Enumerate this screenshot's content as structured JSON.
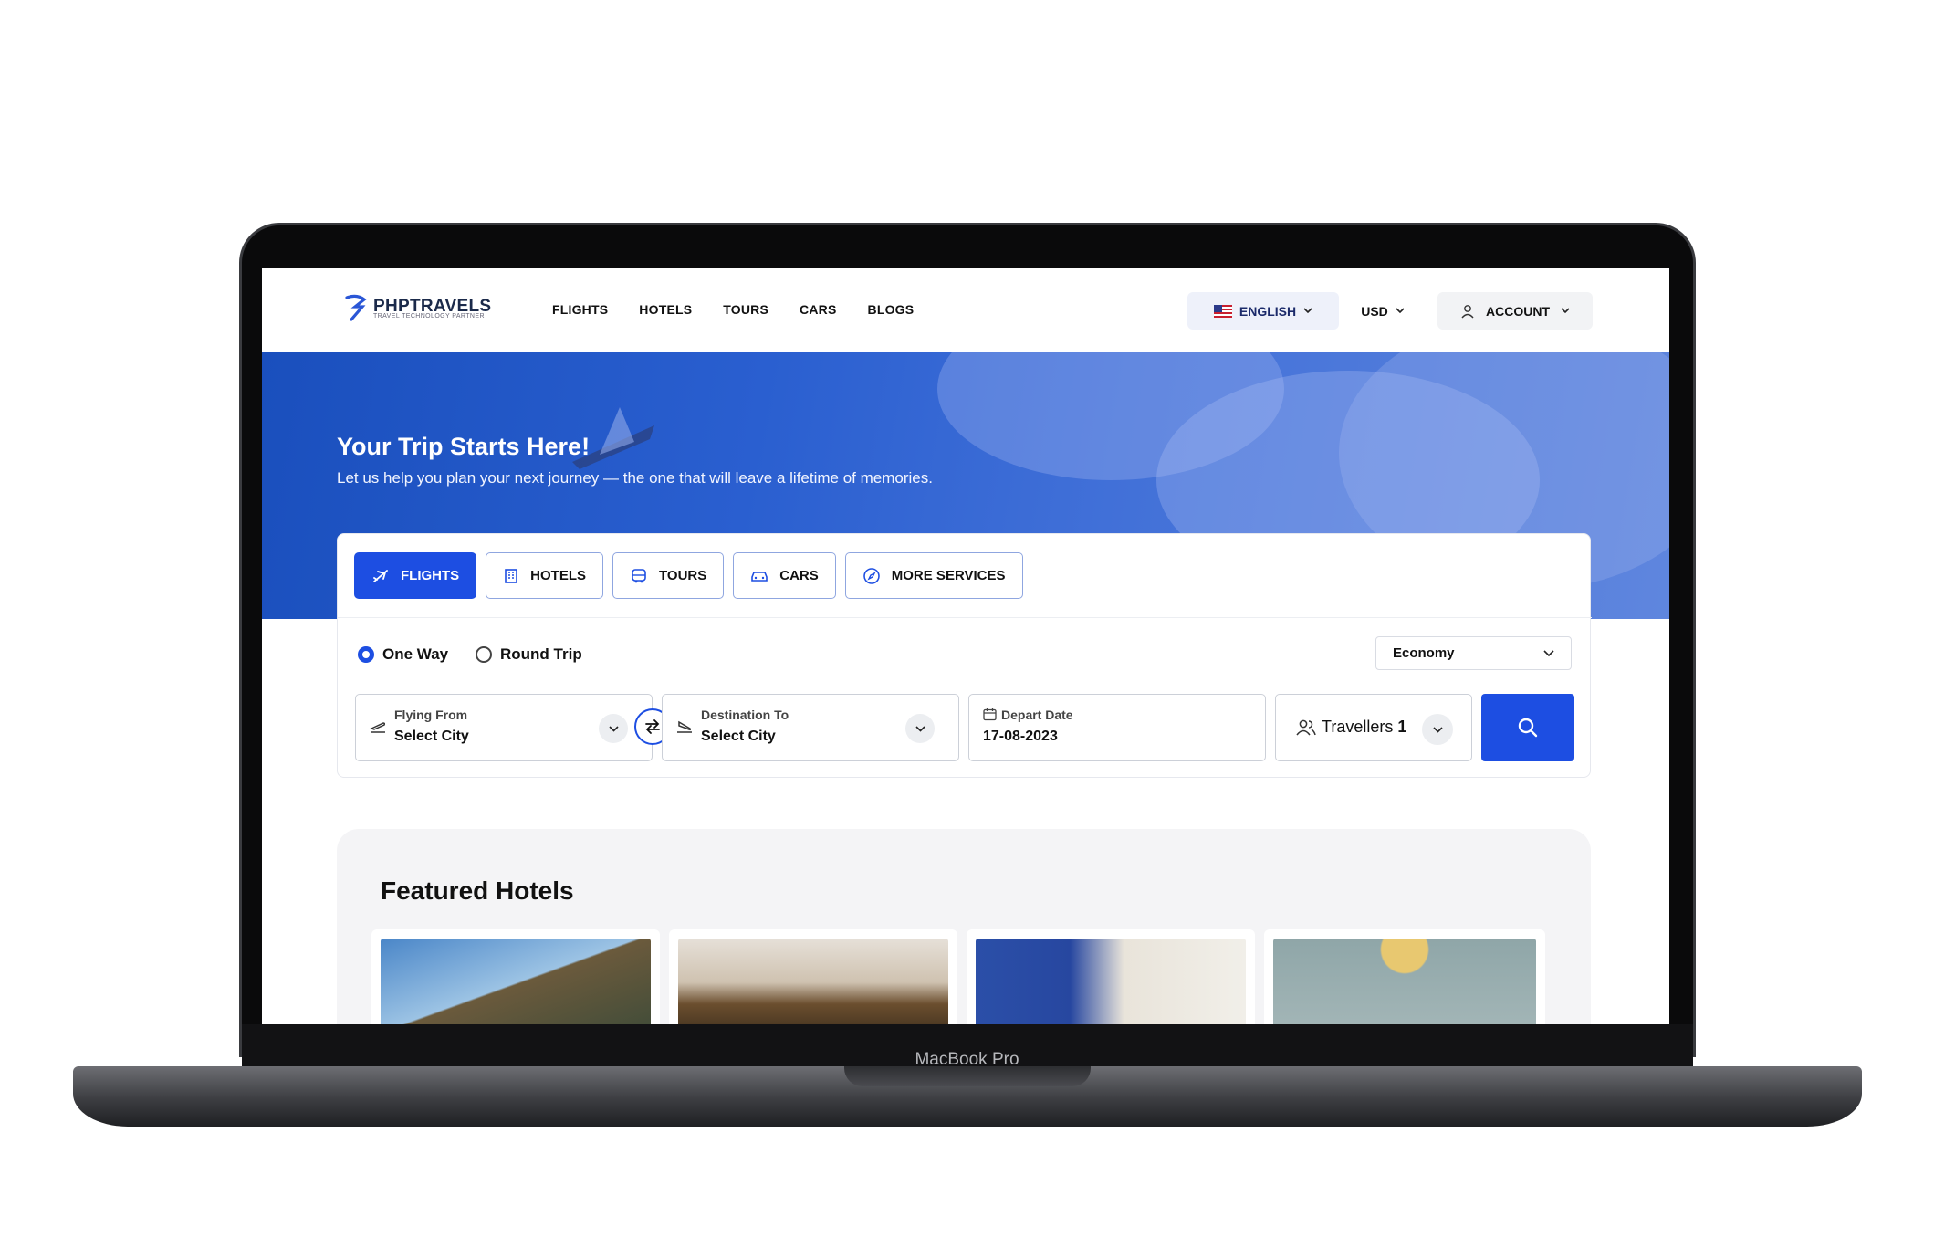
{
  "device": {
    "label": "MacBook Pro"
  },
  "header": {
    "logo_text": "PHPTRAVELS",
    "logo_subtitle": "TRAVEL TECHNOLOGY PARTNER",
    "nav": [
      "FLIGHTS",
      "HOTELS",
      "TOURS",
      "CARS",
      "BLOGS"
    ],
    "language": "ENGLISH",
    "currency": "USD",
    "account": "ACCOUNT"
  },
  "hero": {
    "title": "Your Trip Starts Here!",
    "subtitle": "Let us help you plan your next journey — the one that will leave a lifetime of memories."
  },
  "search": {
    "tabs": [
      "FLIGHTS",
      "HOTELS",
      "TOURS",
      "CARS",
      "MORE SERVICES"
    ],
    "active_tab": "FLIGHTS",
    "trip_types": [
      "One Way",
      "Round Trip"
    ],
    "selected_trip_type": "One Way",
    "cabin_class": "Economy",
    "from": {
      "label": "Flying From",
      "value": "Select City"
    },
    "to": {
      "label": "Destination To",
      "value": "Select City"
    },
    "depart": {
      "label": "Depart Date",
      "value": "17-08-2023"
    },
    "travellers": {
      "label": "Travellers",
      "count": "1"
    }
  },
  "featured": {
    "title": "Featured Hotels"
  },
  "colors": {
    "primary": "#1d4ee2",
    "hero": "#2a5fd0",
    "navy": "#1b2a4a"
  }
}
